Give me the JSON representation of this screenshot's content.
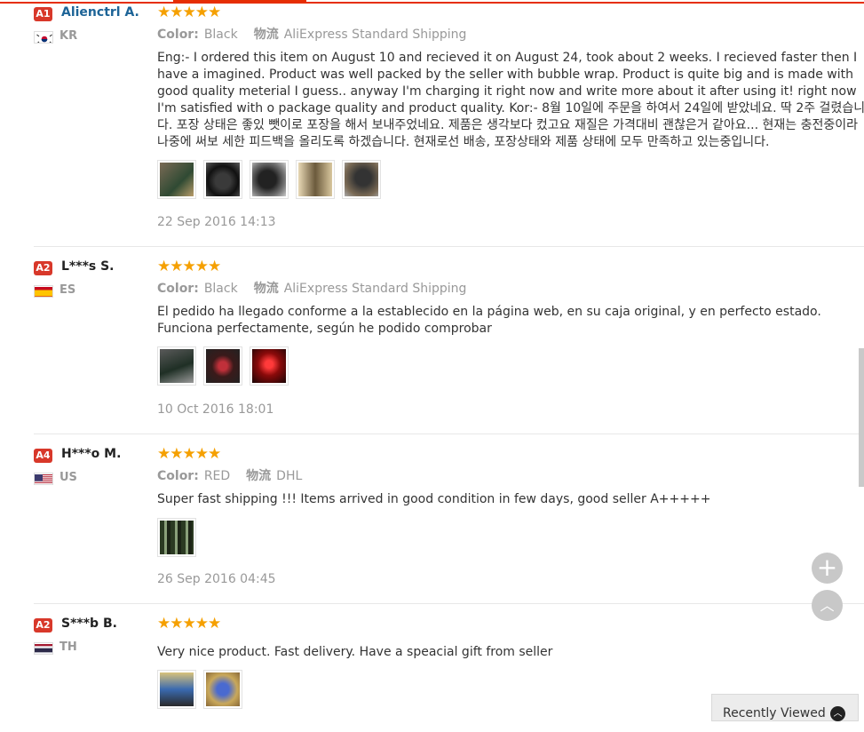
{
  "reviews": [
    {
      "level": "A1",
      "name": "Alienctrl A.",
      "country": "KR",
      "stars": "★★★★★",
      "color_key": "Color:",
      "color_val": "Black",
      "ship_key": "物流",
      "ship_val": "AliExpress Standard Shipping",
      "text": "Eng:- I ordered this item on August 10 and recieved it on August 24, took about 2 weeks. I recieved faster then I have a imagined. Product was well packed by the seller with bubble wrap. Product is quite big and is made with good quality meterial I guess.. anyway I'm charging it right now and write more about it after using it! right now I'm satisfied with o package quality and product quality. Kor:- 8월 10일에 주문을 하여서 24일에 받았네요. 딱 2주 걸렸습니다. 포장 상태은 좋있 뺏이로 포장을 해서 보내주었네요. 제품은 생각보다 컸고요 재질은 가격대비 괜찮은거 같아요... 현재는 충전중이라 나중에 써보 세한 피드백을 올리도록 하겠습니다. 현재로선 배송, 포장상태와 제품 상태에 모두 만족하고 있는중입니다.",
      "date": "22 Sep 2016 14:13"
    },
    {
      "level": "A2",
      "name": "L***s S.",
      "country": "ES",
      "stars": "★★★★★",
      "color_key": "Color:",
      "color_val": "Black",
      "ship_key": "物流",
      "ship_val": "AliExpress Standard Shipping",
      "text": "El pedido ha llegado conforme a la establecido en la página web, en su caja original, y en perfecto estado. Funciona perfectamente, según he podido comprobar",
      "date": "10 Oct 2016 18:01"
    },
    {
      "level": "A4",
      "name": "H***o M.",
      "country": "US",
      "stars": "★★★★★",
      "color_key": "Color:",
      "color_val": "RED",
      "ship_key": "物流",
      "ship_val": "DHL",
      "text": "Super fast shipping !!! Items arrived in good condition in few days, good seller A+++++",
      "date": "26 Sep 2016 04:45"
    },
    {
      "level": "A2",
      "name": "S***b B.",
      "country": "TH",
      "stars": "★★★★★",
      "text": "Very nice product. Fast delivery. Have a speacial gift from seller"
    }
  ],
  "widgets": {
    "plus_icon": "+",
    "back_to_top_icon": "︿",
    "recently_viewed": "Recently Viewed",
    "chevron_up_icon": "︿"
  },
  "colors": {
    "accent": "#e62e04",
    "star": "#f5a000",
    "level_badge": "#d8382a",
    "link_name": "#1d6497"
  }
}
